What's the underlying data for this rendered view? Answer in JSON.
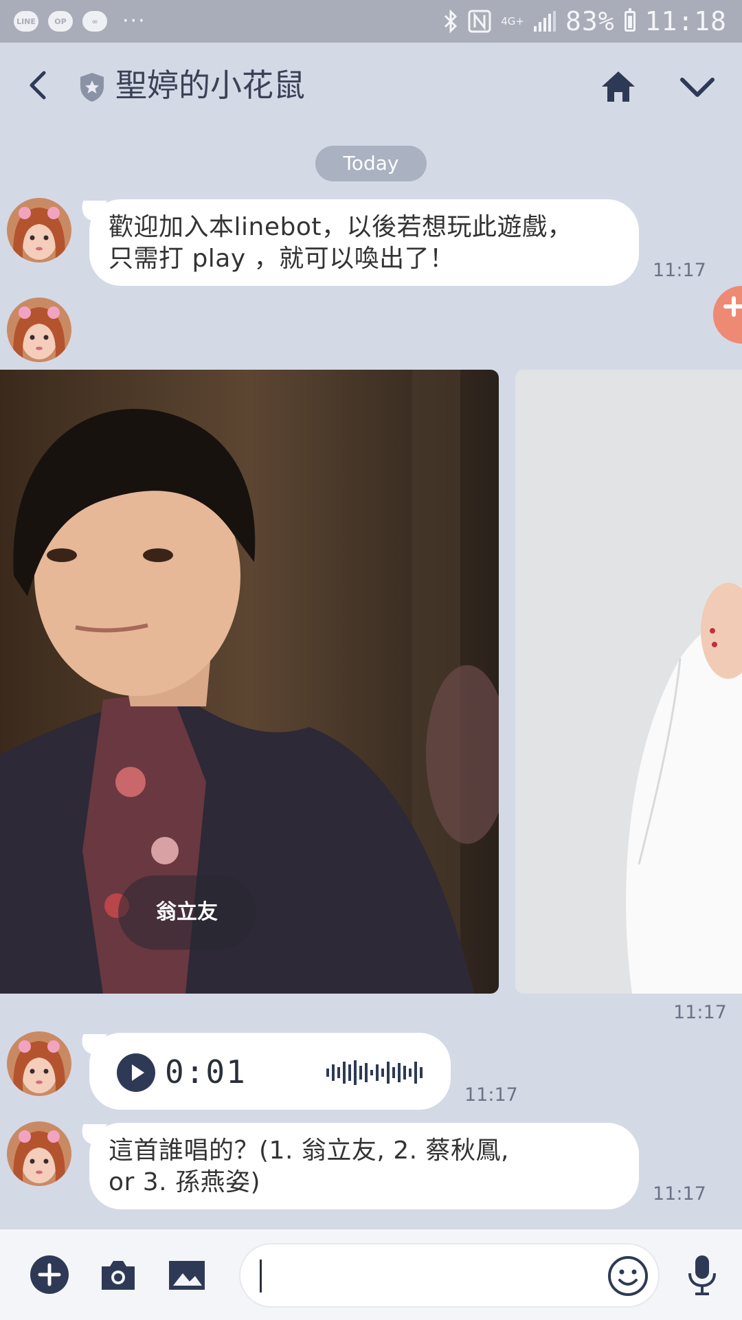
{
  "status_bar": {
    "network": "4G+",
    "battery": "83%",
    "time": "11:18",
    "left_icons": [
      "line-app-icon",
      "op-app-icon",
      "gomaji-app-icon"
    ],
    "dots": "···",
    "pill_labels": [
      "LINE",
      "OP",
      "∞"
    ]
  },
  "header": {
    "title": "聖婷的小花鼠"
  },
  "date_divider": "Today",
  "messages": [
    {
      "type": "text",
      "lines": [
        "歡迎加入本linebot，以後若想玩此遊戲，",
        "只需打 play ，就可以喚出了！"
      ],
      "time": "11:17"
    },
    {
      "type": "carousel",
      "cards": [
        {
          "label": "翁立友"
        },
        {
          "label": ""
        }
      ],
      "time": "11:17"
    },
    {
      "type": "audio",
      "duration": "0:01",
      "time": "11:17"
    },
    {
      "type": "text",
      "lines": [
        "這首誰唱的？(1. 翁立友, 2. 蔡秋鳳,",
        "or 3. 孫燕姿)"
      ],
      "time": "11:17"
    }
  ],
  "input": {
    "value": "",
    "placeholder": ""
  },
  "colors": {
    "background": "#d4d9e6",
    "status_bar": "#a9adb9",
    "accent_dark": "#2e3a55",
    "float_button": "#ee8a73"
  }
}
